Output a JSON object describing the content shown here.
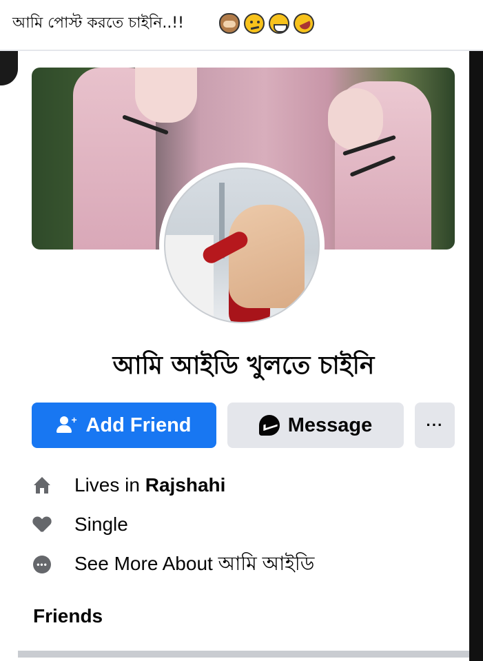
{
  "post": {
    "caption": "আমি পোস্ট করতে চাইনি..!!",
    "caption_emojis": [
      "see-no-evil-monkey-emoji",
      "confused-face-emoji",
      "grinning-face-emoji",
      "rolling-on-floor-laughing-emoji"
    ]
  },
  "profile": {
    "name": "আমি আইডি খুলতে চাইনি",
    "add_friend_label": "Add Friend",
    "message_label": "Message",
    "more_label": "···",
    "lives_in_prefix": "Lives in ",
    "lives_in_city": "Rajshahi",
    "relationship": "Single",
    "see_more_label": "See More About আমি আইডি",
    "friends_heading": "Friends"
  },
  "colors": {
    "primary_button": "#1877f2",
    "secondary_button": "#e4e6eb",
    "icon_gray": "#65676b",
    "text": "#050505"
  },
  "icons": {
    "add_friend": "person-plus-icon",
    "message": "messenger-icon",
    "more": "more-dots-icon",
    "lives_in": "home-icon",
    "relationship": "heart-icon",
    "see_more": "more-dots-circle-icon"
  }
}
